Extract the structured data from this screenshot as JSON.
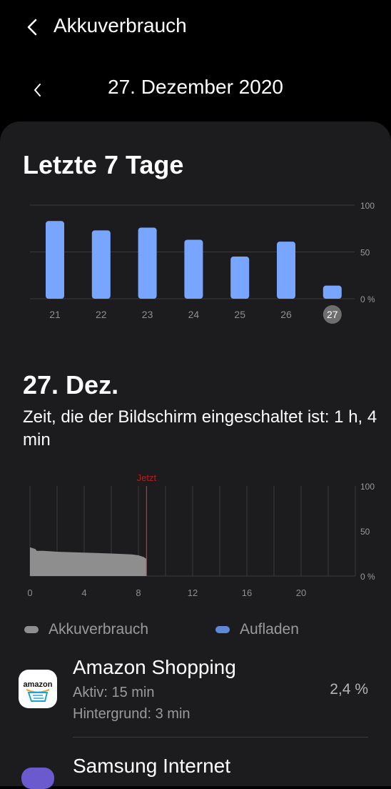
{
  "header": {
    "title": "Akkuverbrauch"
  },
  "date_nav": {
    "date": "27. Dezember 2020"
  },
  "week": {
    "title": "Letzte 7 Tage",
    "selected_day": "27"
  },
  "day": {
    "title": "27. Dez.",
    "screen_on": "Zeit, die der Bildschirm eingeschaltet ist: 1 h, 4 min",
    "now_label": "Jetzt"
  },
  "legend": {
    "usage": "Akkuverbrauch",
    "charging": "Aufladen"
  },
  "colors": {
    "bar": "#78a6ff",
    "usage": "#8e8e8e",
    "now_line": "#e02626",
    "grid": "#3a3a3c"
  },
  "apps": [
    {
      "name": "Amazon Shopping",
      "active": "Aktiv: 15 min",
      "background": "Hintergrund: 3 min",
      "percent": "2,4 %",
      "icon": "amazon-icon"
    },
    {
      "name": "Samsung Internet",
      "icon": "samsung-internet-icon"
    }
  ],
  "chart_data": [
    {
      "type": "bar",
      "title": "Letzte 7 Tage",
      "categories": [
        "21",
        "22",
        "23",
        "24",
        "25",
        "26",
        "27"
      ],
      "values": [
        83,
        73,
        76,
        63,
        45,
        61,
        14
      ],
      "ylim": [
        0,
        100
      ],
      "ytick_labels": [
        "100",
        "50",
        "0 %"
      ],
      "grid": true
    },
    {
      "type": "area",
      "title": "",
      "xlim": [
        0,
        24
      ],
      "xtick_labels": [
        "0",
        "4",
        "8",
        "12",
        "16",
        "20"
      ],
      "ylim": [
        0,
        100
      ],
      "ytick_labels": [
        "100",
        "50",
        "0 %"
      ],
      "x": [
        0,
        0.4,
        0.5,
        1,
        2,
        4,
        6,
        7.5,
        8,
        8.4,
        8.6
      ],
      "values": [
        32,
        30,
        28,
        28,
        27,
        26,
        25,
        24,
        23,
        21,
        19
      ],
      "now_x": 8.6,
      "grid": true
    }
  ]
}
